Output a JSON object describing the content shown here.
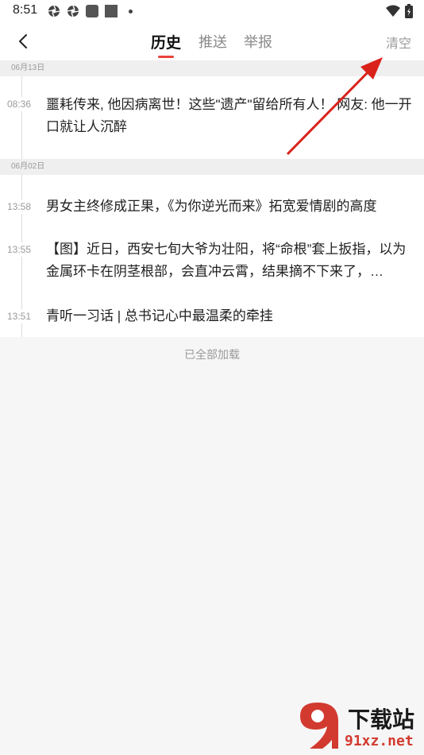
{
  "status_bar": {
    "time": "8:51",
    "icons": [
      "aperture-icon",
      "aperture-icon",
      "rounded-square-icon",
      "square-icon",
      "dot-icon"
    ],
    "right_icons": [
      "wifi-icon",
      "battery-charging-icon"
    ]
  },
  "header": {
    "back_icon": "chevron-left-icon",
    "tabs": [
      {
        "label": "历史",
        "active": true
      },
      {
        "label": "推送",
        "active": false
      },
      {
        "label": "举报",
        "active": false
      }
    ],
    "clear_label": "清空",
    "accent_color": "#e8433b"
  },
  "history": [
    {
      "date": "06月13日",
      "items": [
        {
          "time": "08:36",
          "title": "噩耗传来, 他因病离世！这些\"遗产\"留给所有人！ 网友: 他一开口就让人沉醉"
        }
      ]
    },
    {
      "date": "06月02日",
      "items": [
        {
          "time": "13:58",
          "title": "男女主终修成正果，《为你逆光而来》拓宽爱情剧的高度"
        },
        {
          "time": "13:55",
          "title": "【图】近日，西安七旬大爷为壮阳，将“命根”套上扳指，以为金属环卡在阴茎根部，会直冲云霄，结果摘不下来了，…"
        },
        {
          "time": "13:51",
          "title": "青听一习话 | 总书记心中最温柔的牵挂"
        }
      ]
    }
  ],
  "footer_text": "已全部加载",
  "watermark": {
    "text": "下载站",
    "domain": "91xz.net",
    "logo_color": "#d23a2f"
  }
}
